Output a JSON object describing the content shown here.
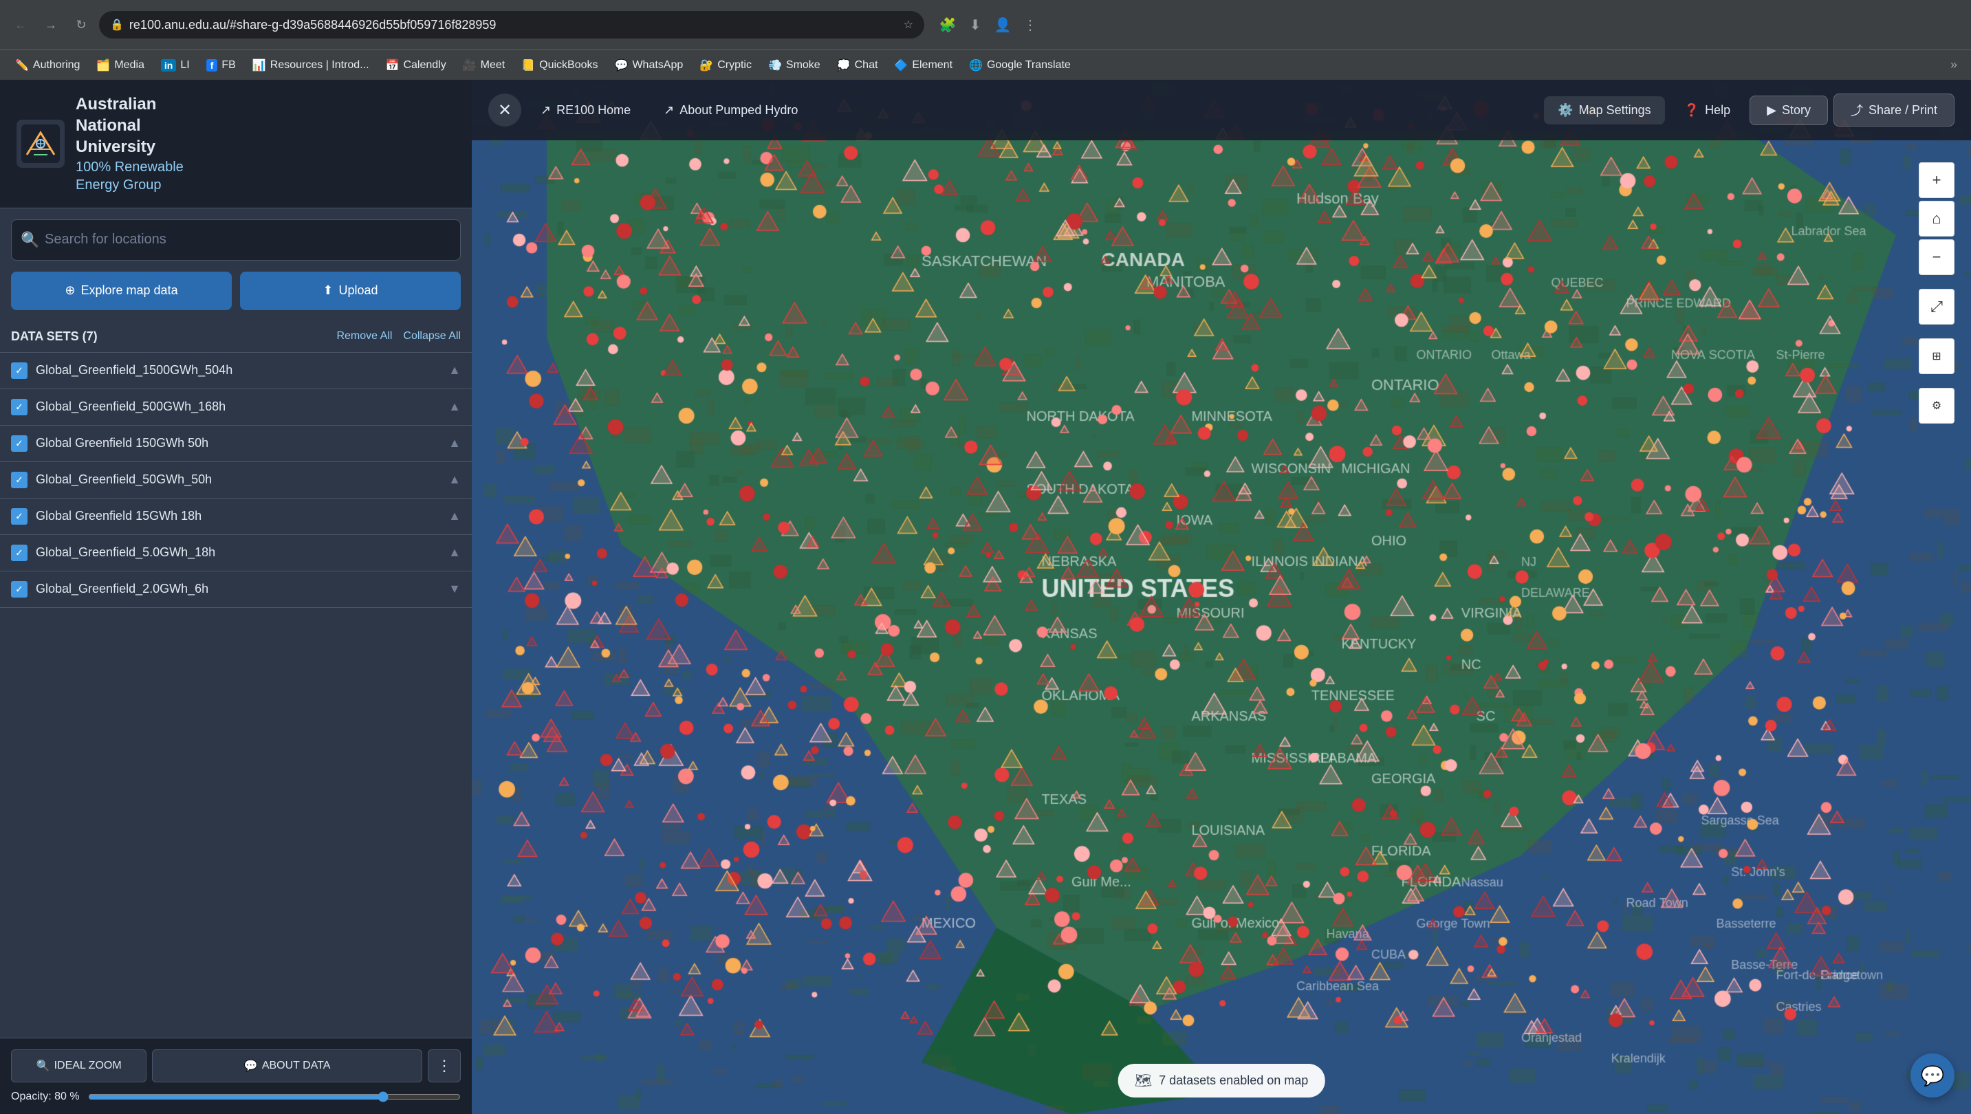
{
  "browser": {
    "url": "re100.anu.edu.au/#share-g-d39a5688446926d55bf059716f828959",
    "back_disabled": false,
    "forward_disabled": false
  },
  "bookmarks": [
    {
      "label": "Authoring",
      "icon": "✏️"
    },
    {
      "label": "Media",
      "icon": "🗂️"
    },
    {
      "label": "LI",
      "icon": "in"
    },
    {
      "label": "FB",
      "icon": "f"
    },
    {
      "label": "Resources | Introd...",
      "icon": "📊"
    },
    {
      "label": "Calendly",
      "icon": "📅"
    },
    {
      "label": "Meet",
      "icon": "🎥"
    },
    {
      "label": "QuickBooks",
      "icon": "📒"
    },
    {
      "label": "WhatsApp",
      "icon": "💬"
    },
    {
      "label": "Cryptic",
      "icon": "🔐"
    },
    {
      "label": "Smoke",
      "icon": "💨"
    },
    {
      "label": "Chat",
      "icon": "💭"
    },
    {
      "label": "Element",
      "icon": "🔷"
    },
    {
      "label": "Google Translate",
      "icon": "🌐"
    }
  ],
  "sidebar": {
    "logo_alt": "ANU Logo",
    "org_line1": "Australian National University",
    "org_line2": "100% Renewable",
    "org_line3": "Energy Group",
    "search_placeholder": "Search for locations",
    "explore_label": "Explore map data",
    "upload_label": "Upload",
    "datasets_title": "DATA SETS (7)",
    "remove_all_label": "Remove All",
    "collapse_all_label": "Collapse All",
    "datasets": [
      {
        "name": "Global_Greenfield_1500GWh_504h",
        "checked": true,
        "id": "ds1"
      },
      {
        "name": "Global_Greenfield_500GWh_168h",
        "checked": true,
        "id": "ds2"
      },
      {
        "name": "Global Greenfield 150GWh 50h",
        "checked": true,
        "id": "ds3"
      },
      {
        "name": "Global_Greenfield_50GWh_50h",
        "checked": true,
        "id": "ds4"
      },
      {
        "name": "Global Greenfield 15GWh 18h",
        "checked": true,
        "id": "ds5"
      },
      {
        "name": "Global_Greenfield_5.0GWh_18h",
        "checked": true,
        "id": "ds6"
      },
      {
        "name": "Global_Greenfield_2.0GWh_6h",
        "checked": true,
        "id": "ds7"
      }
    ],
    "ideal_zoom_label": "IDEAL ZOOM",
    "about_data_label": "ABOUT DATA",
    "opacity_label": "Opacity: 80 %",
    "opacity_value": 80
  },
  "topnav": {
    "re100_home_label": "RE100 Home",
    "about_pumped_hydro_label": "About Pumped Hydro",
    "map_settings_label": "Map Settings",
    "help_label": "Help",
    "story_label": "Story",
    "share_print_label": "Share / Print"
  },
  "map": {
    "status_text": "7 datasets enabled on map",
    "chat_tooltip": "Chat"
  },
  "map_controls": {
    "zoom_in": "+",
    "zoom_out": "−",
    "home": "⌂",
    "fullscreen": "⤢",
    "layers": "⊞",
    "settings": "⚙"
  }
}
